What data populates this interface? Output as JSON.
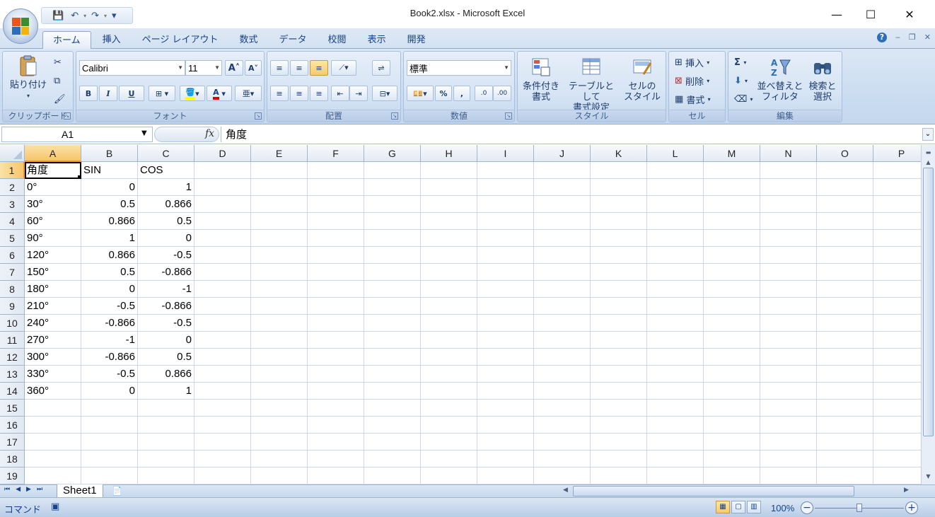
{
  "window": {
    "title": "Book2.xlsx - Microsoft Excel",
    "minimize": "—",
    "maximize": "☐",
    "close": "✕"
  },
  "quick_access": {
    "save": "💾",
    "undo": "↶",
    "redo": "↷",
    "customize": "▾"
  },
  "ribbon_tabs": [
    "ホーム",
    "挿入",
    "ページ レイアウト",
    "数式",
    "データ",
    "校閲",
    "表示",
    "開発"
  ],
  "active_tab": "ホーム",
  "ribbon_controls": {
    "help": "?",
    "min": "‒",
    "restore": "❐",
    "close": "✕"
  },
  "ribbon": {
    "clipboard": {
      "paste": "貼り付け",
      "label": "クリップボード"
    },
    "font": {
      "name": "Calibri",
      "size": "11",
      "grow": "A",
      "shrink": "A",
      "bold": "B",
      "italic": "I",
      "underline": "U",
      "label": "フォント"
    },
    "alignment": {
      "label": "配置"
    },
    "number": {
      "format": "標準",
      "percent": "%",
      "comma": ",",
      "inc_decimal": ".0",
      "dec_decimal": ".00",
      "label": "数値"
    },
    "styles": {
      "conditional": "条件付き",
      "conditional2": "書式",
      "table": "テーブルとして",
      "table2": "書式設定",
      "cell": "セルの",
      "cell2": "スタイル",
      "label": "スタイル"
    },
    "cells": {
      "insert": "挿入",
      "delete": "削除",
      "format": "書式",
      "label": "セル"
    },
    "editing": {
      "sum": "Σ",
      "sort": "並べ替えと",
      "sort2": "フィルタ",
      "find": "検索と",
      "find2": "選択",
      "label": "編集"
    }
  },
  "formula_bar": {
    "name_box": "A1",
    "fx": "fx",
    "formula": "角度"
  },
  "columns": [
    "A",
    "B",
    "C",
    "D",
    "E",
    "F",
    "G",
    "H",
    "I",
    "J",
    "K",
    "L",
    "M",
    "N",
    "O",
    "P"
  ],
  "selected_column": "A",
  "selected_row": "1",
  "rows": [
    {
      "n": "1",
      "a": "角度",
      "b": "SIN",
      "c": "COS"
    },
    {
      "n": "2",
      "a": "0°",
      "b": "0",
      "c": "1"
    },
    {
      "n": "3",
      "a": "30°",
      "b": "0.5",
      "c": "0.866"
    },
    {
      "n": "4",
      "a": "60°",
      "b": "0.866",
      "c": "0.5"
    },
    {
      "n": "5",
      "a": "90°",
      "b": "1",
      "c": "0"
    },
    {
      "n": "6",
      "a": "120°",
      "b": "0.866",
      "c": "-0.5"
    },
    {
      "n": "7",
      "a": "150°",
      "b": "0.5",
      "c": "-0.866"
    },
    {
      "n": "8",
      "a": "180°",
      "b": "0",
      "c": "-1"
    },
    {
      "n": "9",
      "a": "210°",
      "b": "-0.5",
      "c": "-0.866"
    },
    {
      "n": "10",
      "a": "240°",
      "b": "-0.866",
      "c": "-0.5"
    },
    {
      "n": "11",
      "a": "270°",
      "b": "-1",
      "c": "0"
    },
    {
      "n": "12",
      "a": "300°",
      "b": "-0.866",
      "c": "0.5"
    },
    {
      "n": "13",
      "a": "330°",
      "b": "-0.5",
      "c": "0.866"
    },
    {
      "n": "14",
      "a": "360°",
      "b": "0",
      "c": "1"
    },
    {
      "n": "15",
      "a": "",
      "b": "",
      "c": ""
    },
    {
      "n": "16",
      "a": "",
      "b": "",
      "c": ""
    },
    {
      "n": "17",
      "a": "",
      "b": "",
      "c": ""
    },
    {
      "n": "18",
      "a": "",
      "b": "",
      "c": ""
    },
    {
      "n": "19",
      "a": "",
      "b": "",
      "c": ""
    }
  ],
  "sheets": [
    "Sheet1"
  ],
  "status": {
    "mode": "コマンド",
    "zoom": "100%",
    "zoom_out": "−",
    "zoom_in": "+"
  },
  "colors": {
    "accent": "#f7c56b",
    "ribbon": "#c9dbf0",
    "text_blue": "#15428b"
  }
}
